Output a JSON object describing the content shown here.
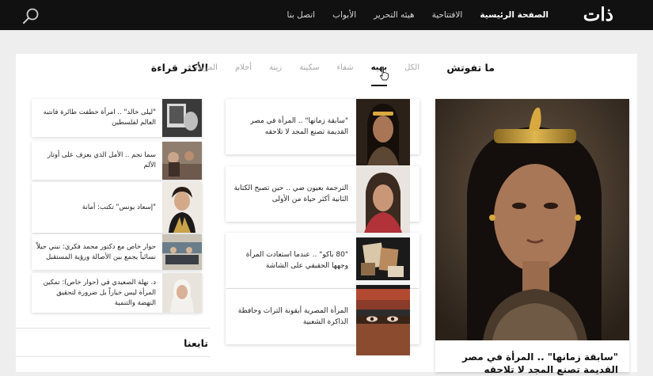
{
  "header": {
    "logo_text": "ذات",
    "nav": [
      {
        "label": "الصفحة الرئيسية",
        "active": true
      },
      {
        "label": "الافتتاحية",
        "active": false
      },
      {
        "label": "هيئه التحرير",
        "active": false
      },
      {
        "label": "الأبواب",
        "active": false
      },
      {
        "label": "اتصل بنا",
        "active": false
      }
    ],
    "search_icon": "search-icon"
  },
  "must_read": {
    "title": "ما تفوتش",
    "tabs": [
      {
        "label": "الكل",
        "active": false
      },
      {
        "label": "بهيه",
        "active": true
      },
      {
        "label": "شفاء",
        "active": false
      },
      {
        "label": "سكينة",
        "active": false
      },
      {
        "label": "زينة",
        "active": false
      },
      {
        "label": "أحلام",
        "active": false
      },
      {
        "label": "المزيد",
        "active": false
      }
    ],
    "featured": {
      "title": "\"سابقة زمانها\" .. المرأة في مصر القديمة تصنع المجد لا تلاحقه"
    },
    "articles": [
      {
        "title": "\"سابقة زمانها\" .. المرأة في مصر القديمة تصنع المجد لا تلاحقه"
      },
      {
        "title": "الترجمة بعيون ضي .. حين تصبح الكتابة الثانية أكثر حياة من الأولى"
      },
      {
        "title": "\"80 باكو\" .. عندما استعادت المرأة وجهها الحقيقي على الشاشة"
      },
      {
        "title": "المرأة المصرية أيقونة التراث وحافظة الذاكرة الشعبية"
      }
    ]
  },
  "most_read": {
    "title": "الأكثر قراءة",
    "items": [
      {
        "title": "\"ليلى خالد\" .. امرأة خطفت طائرة فانتبه العالم لفلسطين"
      },
      {
        "title": "سما نجم .. الأمل الذي يعزف على أوتار الألم"
      },
      {
        "title": "\"إسعاد يونس\" تكتب: أمانة"
      },
      {
        "title": "حوار خاص مع دكتور محمد فكري: نبني جيلاً نسائياً يجمع بين الأصالة ورؤية المستقبل"
      },
      {
        "title": "د. نهلة الصعيدي في (حوار خاص): تمكين المرأة ليس خياراً بل ضرورة لتحقيق النهضة والتنمية"
      }
    ]
  },
  "follow": {
    "title": "تابعنا"
  },
  "colors": {
    "topbar": "#111111",
    "page_bg": "#eeeeee",
    "panel_bg": "#ffffff"
  }
}
